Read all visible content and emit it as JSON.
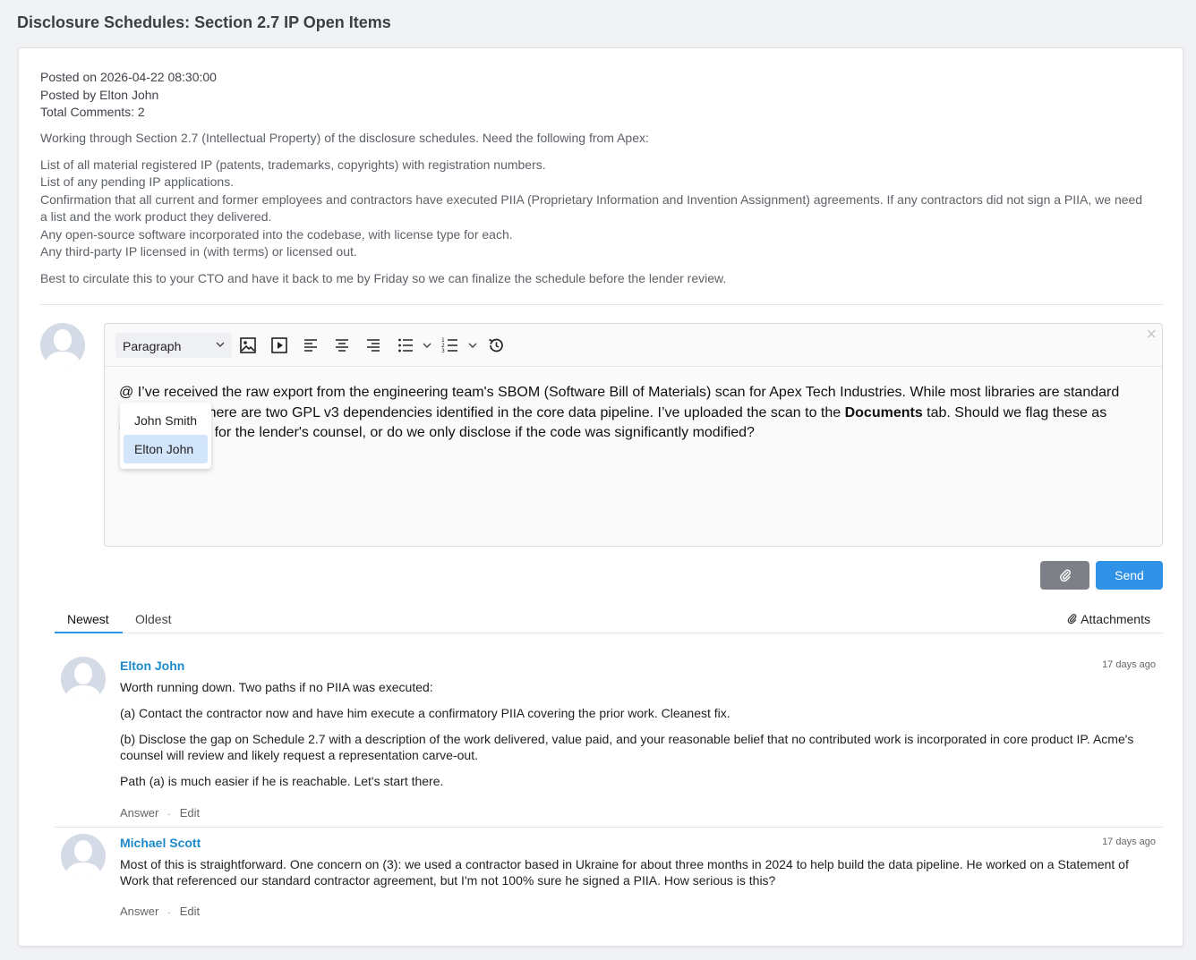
{
  "page": {
    "title": "Disclosure Schedules: Section 2.7 IP Open Items"
  },
  "post": {
    "posted_on": "Posted on 2026-04-22 08:30:00",
    "posted_by": "Posted by Elton John",
    "total_comments": "Total Comments: 2",
    "intro": "Working through Section 2.7 (Intellectual Property) of the disclosure schedules. Need the following from Apex:",
    "items": [
      "List of all material registered IP (patents, trademarks, copyrights) with registration numbers.",
      "List of any pending IP applications.",
      "Confirmation that all current and former employees and contractors have executed PIIA (Proprietary Information and Invention Assignment) agreements. If any contractors did not sign a PIIA, we need a list and the work product they delivered.",
      "Any open-source software incorporated into the codebase, with license type for each.",
      "Any third-party IP licensed in (with terms) or licensed out."
    ],
    "closing": "Best to circulate this to your CTO and have it back to me by Friday so we can finalize the schedule before the lender review."
  },
  "editor": {
    "block_format": "Paragraph",
    "close_glyph": "×",
    "content_before": "@ I’ve received the raw export from the engineering team's SBOM (Software Bill of Materials) scan for Apex Tech Industries. While most libraries are standard MIT/Apache, there are two GPL v3 dependencies identified in the core data pipeline. I’ve uploaded the scan to the ",
    "content_bold": "Documents",
    "content_after": " tab. Should we flag these as 'Copyleft' risks for the lender's counsel, or do we only disclose if the code was significantly modified?",
    "mention_options": [
      "John Smith",
      "Elton John"
    ],
    "mention_selected_index": 1,
    "toolbar_icons": [
      "image-icon",
      "video-icon",
      "align-left-icon",
      "align-center-icon",
      "align-right-icon",
      "bullet-list-icon",
      "numbered-list-icon",
      "history-icon"
    ]
  },
  "actions": {
    "send_label": "Send",
    "attach_icon": "paperclip-icon"
  },
  "tabs": {
    "newest": "Newest",
    "oldest": "Oldest",
    "active": "newest",
    "attachments": "Attachments"
  },
  "comments": [
    {
      "author": "Elton John",
      "time": "17 days ago",
      "paragraphs": [
        "Worth running down. Two paths if no PIIA was executed:",
        "(a) Contact the contractor now and have him execute a confirmatory PIIA covering the prior work. Cleanest fix.",
        "(b) Disclose the gap on Schedule 2.7 with a description of the work delivered, value paid, and your reasonable belief that no contributed work is incorporated in core product IP. Acme's counsel will review and likely request a representation carve-out.",
        "Path (a) is much easier if he is reachable. Let's start there."
      ],
      "answer_label": "Answer",
      "edit_label": "Edit",
      "separator": "·"
    },
    {
      "author": "Michael Scott",
      "time": "17 days ago",
      "paragraphs": [
        "Most of this is straightforward. One concern on (3): we used a contractor based in Ukraine for about three months in 2024 to help build the data pipeline. He worked on a Statement of Work that referenced our standard contractor agreement, but I'm not 100% sure he signed a PIIA. How serious is this?"
      ],
      "answer_label": "Answer",
      "edit_label": "Edit",
      "separator": "·"
    }
  ],
  "colors": {
    "accent": "#2f92e6",
    "author_link": "#1d8ac9",
    "attach_button": "#7d8187",
    "mention_highlight": "#d3e5fb"
  }
}
